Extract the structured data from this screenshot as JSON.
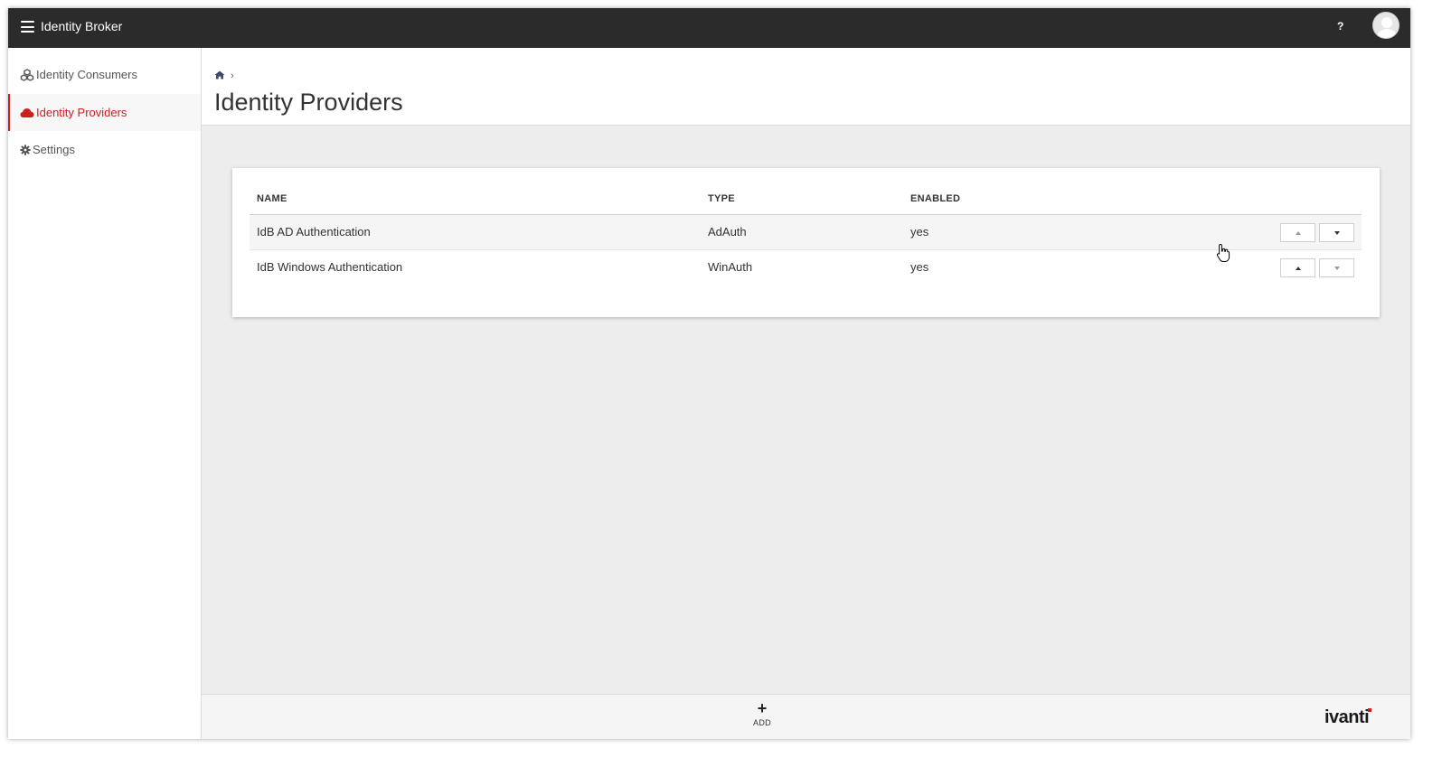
{
  "app": {
    "title": "Identity Broker"
  },
  "topbar": {
    "help_label": "?"
  },
  "sidebar": {
    "items": [
      {
        "label": "Identity Consumers",
        "icon": "cubes-icon",
        "active": false
      },
      {
        "label": "Identity Providers",
        "icon": "cloud-icon",
        "active": true
      },
      {
        "label": "Settings",
        "icon": "gear-icon",
        "active": false
      }
    ]
  },
  "breadcrumb": {
    "home_icon": "home-icon",
    "separator": "›"
  },
  "page": {
    "title": "Identity Providers"
  },
  "table": {
    "columns": [
      "NAME",
      "TYPE",
      "ENABLED"
    ],
    "rows": [
      {
        "name": "IdB AD Authentication",
        "type": "AdAuth",
        "enabled": "yes"
      },
      {
        "name": "IdB Windows Authentication",
        "type": "WinAuth",
        "enabled": "yes"
      }
    ]
  },
  "footer": {
    "add_symbol": "+",
    "add_label": "ADD",
    "brand": "ivanti"
  },
  "colors": {
    "topbar": "#2b2b2b",
    "accent": "#cc1f1f",
    "background": "#ededed"
  }
}
